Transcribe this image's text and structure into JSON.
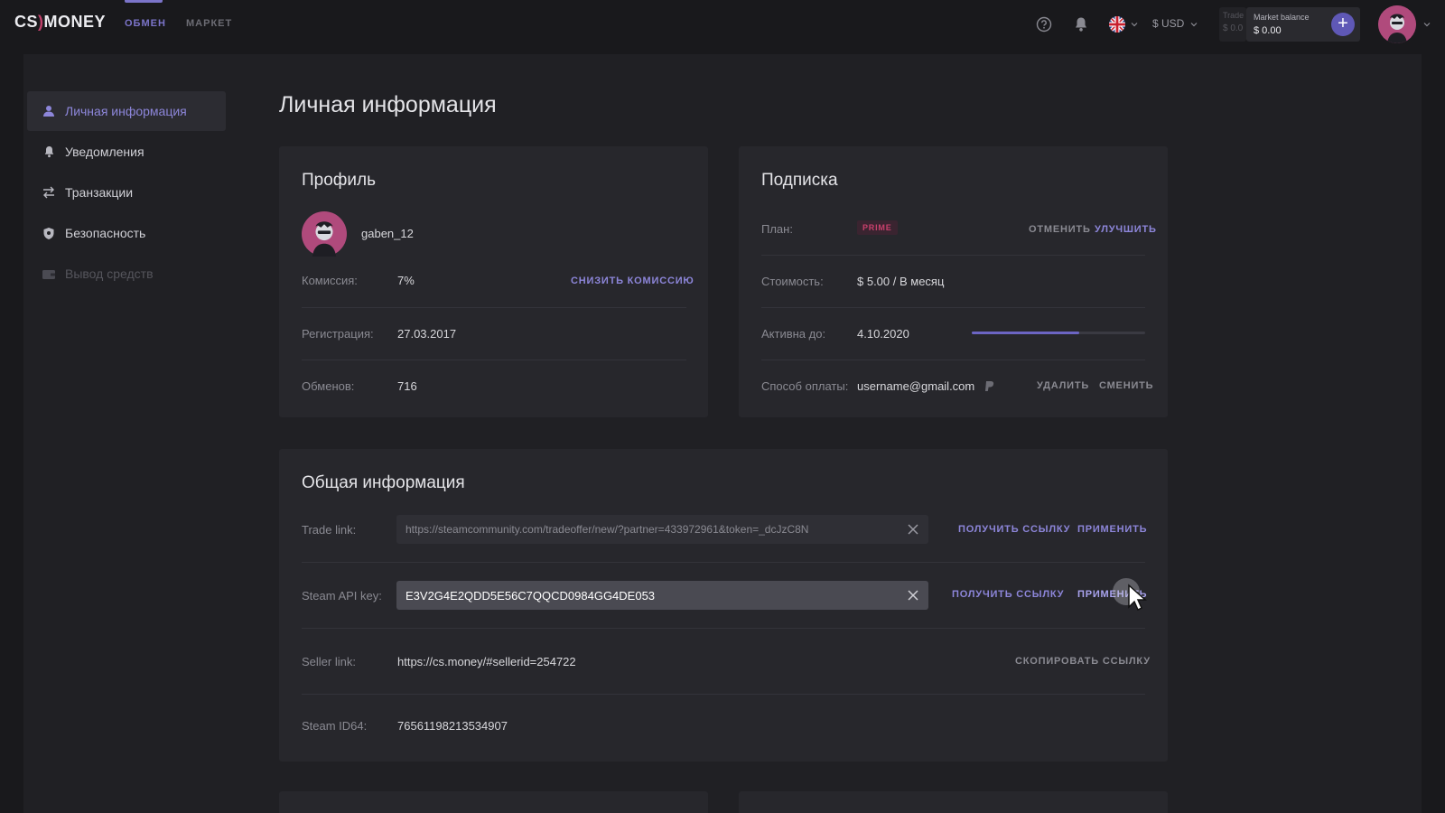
{
  "header": {
    "logo_left": "CS",
    "logo_slash": ")",
    "logo_right": "MONEY",
    "tabs": [
      {
        "label": "ОБМЕН",
        "active": true
      },
      {
        "label": "МАРКЕТ",
        "active": false
      }
    ],
    "currency": "$ USD",
    "trade_balance_label": "Trade",
    "trade_balance_value": "$ 0.0",
    "market_balance_label": "Market balance",
    "market_balance_value": "$ 0.00",
    "add_funds": "+"
  },
  "sidebar": {
    "items": [
      {
        "label": "Личная информация",
        "icon": "user-icon",
        "active": true
      },
      {
        "label": "Уведомления",
        "icon": "bell-icon",
        "active": false
      },
      {
        "label": "Транзакции",
        "icon": "transfer-icon",
        "active": false
      },
      {
        "label": "Безопасность",
        "icon": "shield-icon",
        "active": false
      },
      {
        "label": "Вывод средств",
        "icon": "wallet-icon",
        "disabled": true
      }
    ]
  },
  "page": {
    "title": "Личная информация"
  },
  "profile": {
    "title": "Профиль",
    "username": "gaben_12",
    "commission_label": "Комиссия:",
    "commission_value": "7%",
    "commission_action": "СНИЗИТЬ КОМИССИЮ",
    "registration_label": "Регистрация:",
    "registration_value": "27.03.2017",
    "trades_label": "Обменов:",
    "trades_value": "716"
  },
  "subscription": {
    "title": "Подписка",
    "plan_label": "План:",
    "plan_badge": "PRIME",
    "cancel_action": "ОТМЕНИТЬ",
    "upgrade_action": "УЛУЧШИТЬ",
    "cost_label": "Стоимость:",
    "cost_value": "$ 5.00 / В месяц",
    "active_label": "Активна до:",
    "active_value": "4.10.2020",
    "active_progress": 0.62,
    "payment_label": "Способ оплаты:",
    "payment_value": "username@gmail.com",
    "delete_action": "УДАЛИТЬ",
    "change_action": "СМЕНИТЬ"
  },
  "general": {
    "title": "Общая информация",
    "trade_link_label": "Trade link:",
    "trade_link_value": "https://steamcommunity.com/tradeoffer/new/?partner=433972961&token=_dcJzC8N",
    "get_link_action": "ПОЛУЧИТЬ ССЫЛКУ",
    "apply_action": "ПРИМЕНИТЬ",
    "api_key_label": "Steam API key:",
    "api_key_value": "E3V2G4E2QDD5E56C7QQCD0984GG4DE053",
    "seller_link_label": "Seller link:",
    "seller_link_value": "https://cs.money/#sellerid=254722",
    "copy_link_action": "СКОПИРОВАТЬ ССЫЛКУ",
    "steam_id_label": "Steam ID64:",
    "steam_id_value": "76561198213534907"
  },
  "colors": {
    "accent": "#8d86da",
    "prime": "#c8406c",
    "background": "#19191c",
    "card": "#27272c"
  }
}
